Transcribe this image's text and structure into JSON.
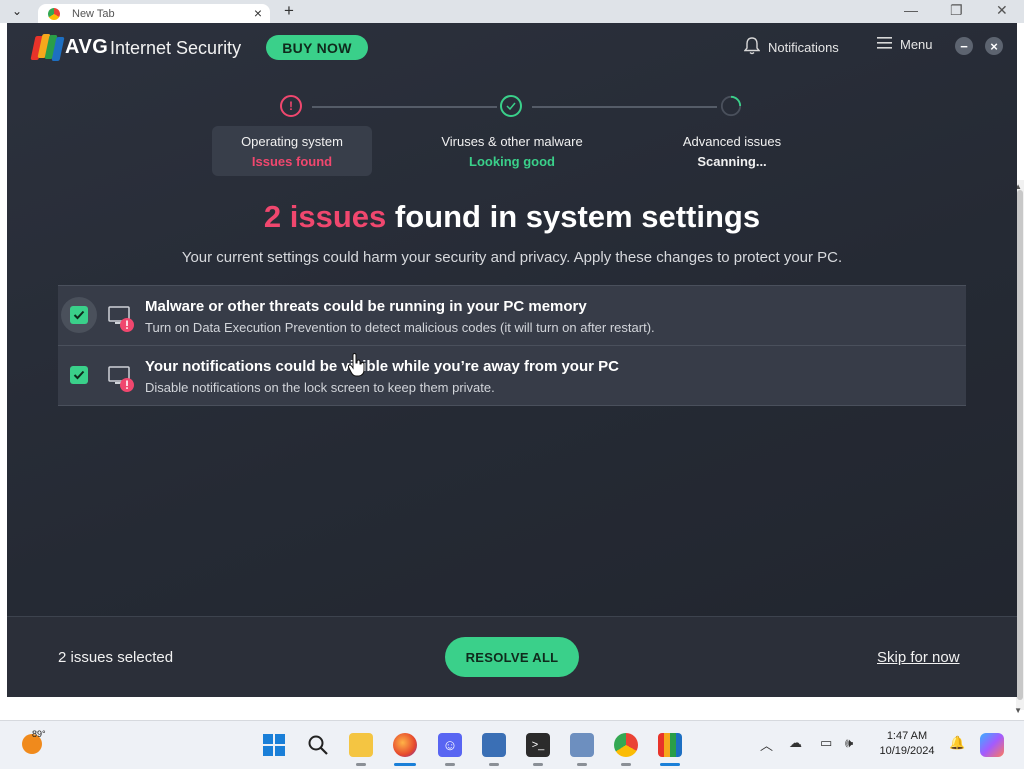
{
  "browser": {
    "tab_title": "New Tab"
  },
  "app": {
    "brand": "AVG",
    "product": "Internet Security",
    "buy_now": "BUY NOW",
    "notifications": "Notifications",
    "menu": "Menu"
  },
  "steps": [
    {
      "name": "Operating system",
      "status": "Issues found",
      "status_color": "#f0476e",
      "state": "issues"
    },
    {
      "name": "Viruses & other malware",
      "status": "Looking good",
      "status_color": "#3ad08a",
      "state": "ok"
    },
    {
      "name": "Advanced issues",
      "status": "Scanning...",
      "status_color": "#f1f1f1",
      "state": "scanning"
    }
  ],
  "headline": {
    "count": "2 issues",
    "rest": " found in system settings"
  },
  "subline": "Your current settings could harm your security and privacy. Apply these changes to protect your PC.",
  "issues": [
    {
      "title": "Malware or other threats could be running in your PC memory",
      "desc": "Turn on Data Execution Prevention to detect malicious codes (it will turn on after restart).",
      "checked": true
    },
    {
      "title": "Your notifications could be visible while you’re away from your PC",
      "desc": "Disable notifications on the lock screen to keep them private.",
      "checked": true
    }
  ],
  "footer": {
    "selected": "2 issues selected",
    "resolve": "RESOLVE ALL",
    "skip": "Skip for now"
  },
  "taskbar": {
    "temperature": "89°",
    "time": "1:47 AM",
    "date": "10/19/2024"
  },
  "colors": {
    "accent_green": "#3ad08a",
    "alert_red": "#f0476e",
    "background": "#2c313d"
  }
}
